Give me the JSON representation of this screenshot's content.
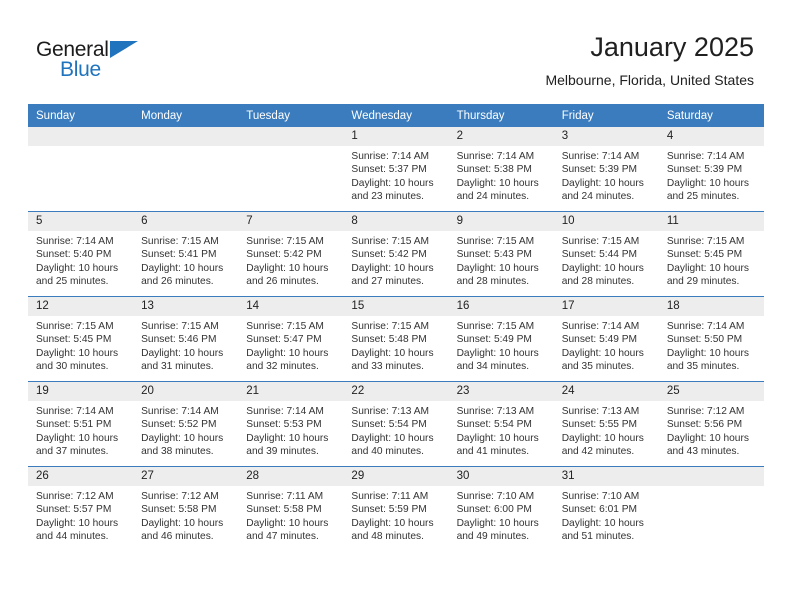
{
  "brand": {
    "name_part1": "General",
    "name_part2": "Blue",
    "flag_icon": "triangle-flag-icon",
    "accent_color": "#1f74bd"
  },
  "header": {
    "title": "January 2025",
    "subtitle": "Melbourne, Florida, United States"
  },
  "calendar": {
    "header_bg": "#3a7cbe",
    "daynum_bg": "#ededed",
    "weekday_headers": [
      "Sunday",
      "Monday",
      "Tuesday",
      "Wednesday",
      "Thursday",
      "Friday",
      "Saturday"
    ],
    "weeks": [
      [
        {
          "day": "",
          "empty": true
        },
        {
          "day": "",
          "empty": true
        },
        {
          "day": "",
          "empty": true
        },
        {
          "day": "1",
          "sunrise": "Sunrise: 7:14 AM",
          "sunset": "Sunset: 5:37 PM",
          "daylight": "Daylight: 10 hours and 23 minutes."
        },
        {
          "day": "2",
          "sunrise": "Sunrise: 7:14 AM",
          "sunset": "Sunset: 5:38 PM",
          "daylight": "Daylight: 10 hours and 24 minutes."
        },
        {
          "day": "3",
          "sunrise": "Sunrise: 7:14 AM",
          "sunset": "Sunset: 5:39 PM",
          "daylight": "Daylight: 10 hours and 24 minutes."
        },
        {
          "day": "4",
          "sunrise": "Sunrise: 7:14 AM",
          "sunset": "Sunset: 5:39 PM",
          "daylight": "Daylight: 10 hours and 25 minutes."
        }
      ],
      [
        {
          "day": "5",
          "sunrise": "Sunrise: 7:14 AM",
          "sunset": "Sunset: 5:40 PM",
          "daylight": "Daylight: 10 hours and 25 minutes."
        },
        {
          "day": "6",
          "sunrise": "Sunrise: 7:15 AM",
          "sunset": "Sunset: 5:41 PM",
          "daylight": "Daylight: 10 hours and 26 minutes."
        },
        {
          "day": "7",
          "sunrise": "Sunrise: 7:15 AM",
          "sunset": "Sunset: 5:42 PM",
          "daylight": "Daylight: 10 hours and 26 minutes."
        },
        {
          "day": "8",
          "sunrise": "Sunrise: 7:15 AM",
          "sunset": "Sunset: 5:42 PM",
          "daylight": "Daylight: 10 hours and 27 minutes."
        },
        {
          "day": "9",
          "sunrise": "Sunrise: 7:15 AM",
          "sunset": "Sunset: 5:43 PM",
          "daylight": "Daylight: 10 hours and 28 minutes."
        },
        {
          "day": "10",
          "sunrise": "Sunrise: 7:15 AM",
          "sunset": "Sunset: 5:44 PM",
          "daylight": "Daylight: 10 hours and 28 minutes."
        },
        {
          "day": "11",
          "sunrise": "Sunrise: 7:15 AM",
          "sunset": "Sunset: 5:45 PM",
          "daylight": "Daylight: 10 hours and 29 minutes."
        }
      ],
      [
        {
          "day": "12",
          "sunrise": "Sunrise: 7:15 AM",
          "sunset": "Sunset: 5:45 PM",
          "daylight": "Daylight: 10 hours and 30 minutes."
        },
        {
          "day": "13",
          "sunrise": "Sunrise: 7:15 AM",
          "sunset": "Sunset: 5:46 PM",
          "daylight": "Daylight: 10 hours and 31 minutes."
        },
        {
          "day": "14",
          "sunrise": "Sunrise: 7:15 AM",
          "sunset": "Sunset: 5:47 PM",
          "daylight": "Daylight: 10 hours and 32 minutes."
        },
        {
          "day": "15",
          "sunrise": "Sunrise: 7:15 AM",
          "sunset": "Sunset: 5:48 PM",
          "daylight": "Daylight: 10 hours and 33 minutes."
        },
        {
          "day": "16",
          "sunrise": "Sunrise: 7:15 AM",
          "sunset": "Sunset: 5:49 PM",
          "daylight": "Daylight: 10 hours and 34 minutes."
        },
        {
          "day": "17",
          "sunrise": "Sunrise: 7:14 AM",
          "sunset": "Sunset: 5:49 PM",
          "daylight": "Daylight: 10 hours and 35 minutes."
        },
        {
          "day": "18",
          "sunrise": "Sunrise: 7:14 AM",
          "sunset": "Sunset: 5:50 PM",
          "daylight": "Daylight: 10 hours and 35 minutes."
        }
      ],
      [
        {
          "day": "19",
          "sunrise": "Sunrise: 7:14 AM",
          "sunset": "Sunset: 5:51 PM",
          "daylight": "Daylight: 10 hours and 37 minutes."
        },
        {
          "day": "20",
          "sunrise": "Sunrise: 7:14 AM",
          "sunset": "Sunset: 5:52 PM",
          "daylight": "Daylight: 10 hours and 38 minutes."
        },
        {
          "day": "21",
          "sunrise": "Sunrise: 7:14 AM",
          "sunset": "Sunset: 5:53 PM",
          "daylight": "Daylight: 10 hours and 39 minutes."
        },
        {
          "day": "22",
          "sunrise": "Sunrise: 7:13 AM",
          "sunset": "Sunset: 5:54 PM",
          "daylight": "Daylight: 10 hours and 40 minutes."
        },
        {
          "day": "23",
          "sunrise": "Sunrise: 7:13 AM",
          "sunset": "Sunset: 5:54 PM",
          "daylight": "Daylight: 10 hours and 41 minutes."
        },
        {
          "day": "24",
          "sunrise": "Sunrise: 7:13 AM",
          "sunset": "Sunset: 5:55 PM",
          "daylight": "Daylight: 10 hours and 42 minutes."
        },
        {
          "day": "25",
          "sunrise": "Sunrise: 7:12 AM",
          "sunset": "Sunset: 5:56 PM",
          "daylight": "Daylight: 10 hours and 43 minutes."
        }
      ],
      [
        {
          "day": "26",
          "sunrise": "Sunrise: 7:12 AM",
          "sunset": "Sunset: 5:57 PM",
          "daylight": "Daylight: 10 hours and 44 minutes."
        },
        {
          "day": "27",
          "sunrise": "Sunrise: 7:12 AM",
          "sunset": "Sunset: 5:58 PM",
          "daylight": "Daylight: 10 hours and 46 minutes."
        },
        {
          "day": "28",
          "sunrise": "Sunrise: 7:11 AM",
          "sunset": "Sunset: 5:58 PM",
          "daylight": "Daylight: 10 hours and 47 minutes."
        },
        {
          "day": "29",
          "sunrise": "Sunrise: 7:11 AM",
          "sunset": "Sunset: 5:59 PM",
          "daylight": "Daylight: 10 hours and 48 minutes."
        },
        {
          "day": "30",
          "sunrise": "Sunrise: 7:10 AM",
          "sunset": "Sunset: 6:00 PM",
          "daylight": "Daylight: 10 hours and 49 minutes."
        },
        {
          "day": "31",
          "sunrise": "Sunrise: 7:10 AM",
          "sunset": "Sunset: 6:01 PM",
          "daylight": "Daylight: 10 hours and 51 minutes."
        },
        {
          "day": "",
          "empty": true
        }
      ]
    ]
  }
}
